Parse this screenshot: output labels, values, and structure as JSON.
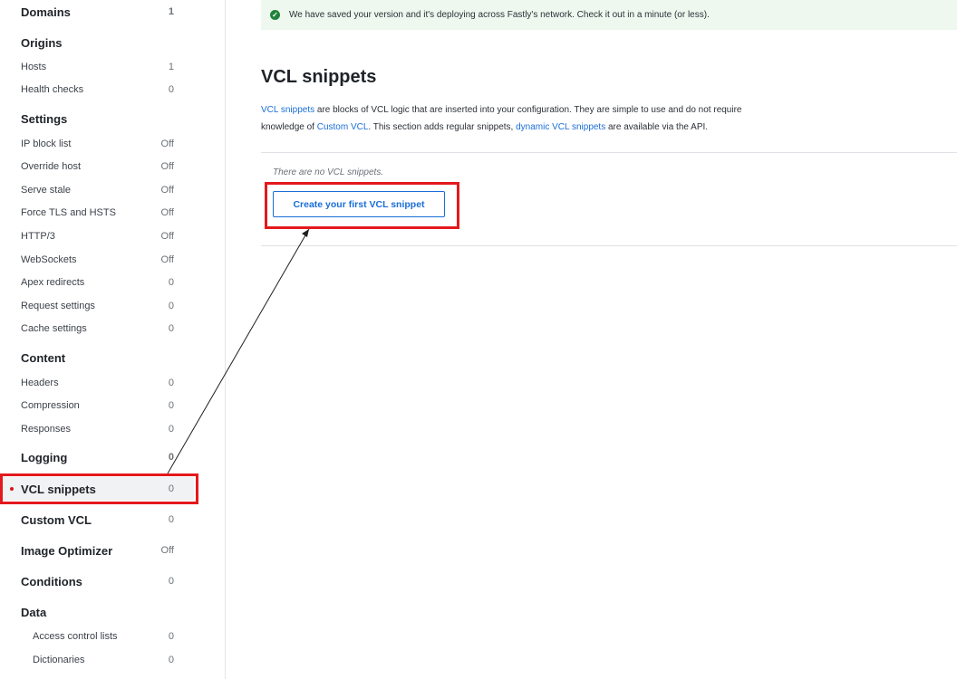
{
  "sidebar": {
    "domains": {
      "label": "Domains",
      "count": "1"
    },
    "origins": {
      "label": "Origins"
    },
    "hosts": {
      "label": "Hosts",
      "count": "1"
    },
    "health_checks": {
      "label": "Health checks",
      "count": "0"
    },
    "settings": {
      "label": "Settings"
    },
    "ip_block_list": {
      "label": "IP block list",
      "count": "Off"
    },
    "override_host": {
      "label": "Override host",
      "count": "Off"
    },
    "serve_stale": {
      "label": "Serve stale",
      "count": "Off"
    },
    "force_tls": {
      "label": "Force TLS and HSTS",
      "count": "Off"
    },
    "http3": {
      "label": "HTTP/3",
      "count": "Off"
    },
    "websockets": {
      "label": "WebSockets",
      "count": "Off"
    },
    "apex_redirects": {
      "label": "Apex redirects",
      "count": "0"
    },
    "request_settings": {
      "label": "Request settings",
      "count": "0"
    },
    "cache_settings": {
      "label": "Cache settings",
      "count": "0"
    },
    "content": {
      "label": "Content"
    },
    "headers": {
      "label": "Headers",
      "count": "0"
    },
    "compression": {
      "label": "Compression",
      "count": "0"
    },
    "responses": {
      "label": "Responses",
      "count": "0"
    },
    "logging": {
      "label": "Logging",
      "count": "0"
    },
    "vcl_snippets": {
      "label": "VCL snippets",
      "count": "0"
    },
    "custom_vcl": {
      "label": "Custom VCL",
      "count": "0"
    },
    "image_optimizer": {
      "label": "Image Optimizer",
      "count": "Off"
    },
    "conditions": {
      "label": "Conditions",
      "count": "0"
    },
    "data": {
      "label": "Data"
    },
    "acl": {
      "label": "Access control lists",
      "count": "0"
    },
    "dictionaries": {
      "label": "Dictionaries",
      "count": "0"
    }
  },
  "alert": {
    "message": "We have saved your version and it's deploying across Fastly's network. Check it out in a minute (or less).",
    "icon": "check-circle-icon",
    "color": "#21833b"
  },
  "main": {
    "title": "VCL snippets",
    "desc": {
      "link1": "VCL snippets",
      "text1": " are blocks of VCL logic that are inserted into your configuration. They are simple to use and do not require",
      "text2": "knowledge of ",
      "link2": "Custom VCL",
      "text3": ". This section adds regular snippets, ",
      "link3": "dynamic VCL snippets",
      "text4": " are available via the API."
    },
    "empty_text": "There are no VCL snippets.",
    "create_button": "Create your first VCL snippet"
  },
  "colors": {
    "accent": "#1a6ed8",
    "highlight": "#e3191d",
    "active_dot": "#d6151d"
  }
}
